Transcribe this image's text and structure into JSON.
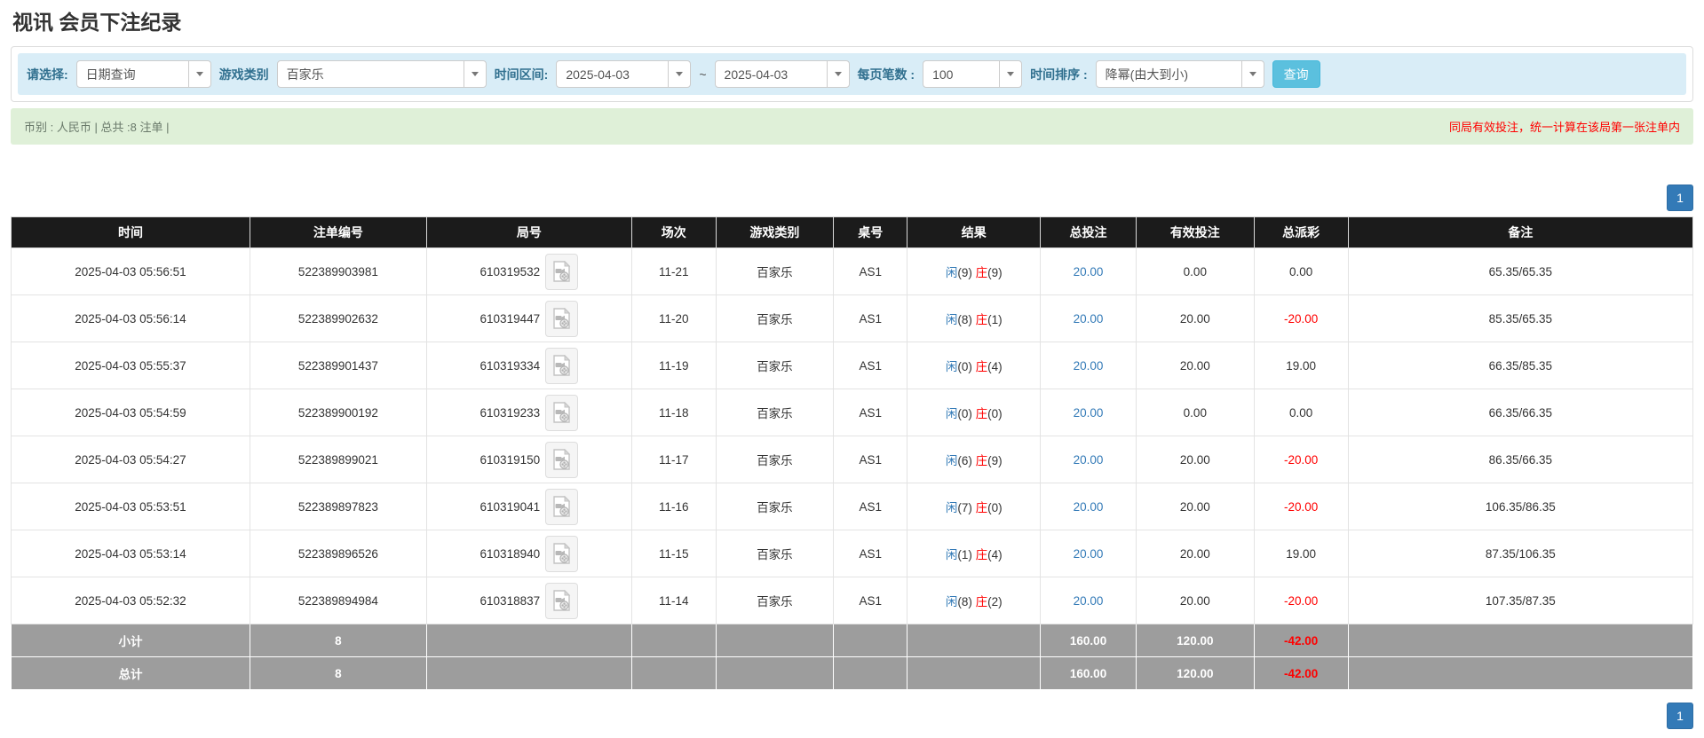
{
  "page": {
    "title": "视讯 会员下注纪录"
  },
  "filters": {
    "select_label": "请选择:",
    "query_type": "日期查询",
    "game_category_label": "游戏类别",
    "game_category": "百家乐",
    "time_range_label": "时间区间:",
    "date_from": "2025-04-03",
    "range_separator": "~",
    "date_to": "2025-04-03",
    "page_size_label": "每页笔数 :",
    "page_size": "100",
    "sort_label": "时间排序 :",
    "sort_order": "降幂(由大到小)",
    "search_button": "查询"
  },
  "summary": {
    "left_text": "币别 : 人民币 | 总共 :8 注单 |",
    "notice": "同局有效投注，统一计算在该局第一张注单内"
  },
  "pagination": {
    "page": "1"
  },
  "colors": {
    "accent_blue": "#337ab7",
    "banker_red": "#ff0000",
    "header_bg": "#1b1b1b",
    "footer_bg": "#9d9d9d",
    "filter_bg": "#d9edf7",
    "summary_bg": "#dff0d8",
    "search_button_bg": "#5bc0de"
  },
  "icons": {
    "video_icon": "video-replay-icon",
    "caret_icon": "chevron-down-icon"
  },
  "table": {
    "headers": [
      "时间",
      "注单编号",
      "局号",
      "场次",
      "游戏类别",
      "桌号",
      "结果",
      "总投注",
      "有效投注",
      "总派彩",
      "备注"
    ],
    "rows": [
      {
        "time": "2025-04-03 05:56:51",
        "bet_id": "522389903981",
        "round_id": "610319532",
        "session": "11-21",
        "game": "百家乐",
        "table_no": "AS1",
        "result": {
          "p_label": "闲",
          "p_val": "(9) ",
          "b_label": "庄",
          "b_val": "(9)"
        },
        "total_bet": "20.00",
        "valid_bet": "0.00",
        "payout": "0.00",
        "remark": "65.35/65.35"
      },
      {
        "time": "2025-04-03 05:56:14",
        "bet_id": "522389902632",
        "round_id": "610319447",
        "session": "11-20",
        "game": "百家乐",
        "table_no": "AS1",
        "result": {
          "p_label": "闲",
          "p_val": "(8) ",
          "b_label": "庄",
          "b_val": "(1)"
        },
        "total_bet": "20.00",
        "valid_bet": "20.00",
        "payout": "-20.00",
        "remark": "85.35/65.35"
      },
      {
        "time": "2025-04-03 05:55:37",
        "bet_id": "522389901437",
        "round_id": "610319334",
        "session": "11-19",
        "game": "百家乐",
        "table_no": "AS1",
        "result": {
          "p_label": "闲",
          "p_val": "(0) ",
          "b_label": "庄",
          "b_val": "(4)"
        },
        "total_bet": "20.00",
        "valid_bet": "20.00",
        "payout": "19.00",
        "remark": "66.35/85.35"
      },
      {
        "time": "2025-04-03 05:54:59",
        "bet_id": "522389900192",
        "round_id": "610319233",
        "session": "11-18",
        "game": "百家乐",
        "table_no": "AS1",
        "result": {
          "p_label": "闲",
          "p_val": "(0) ",
          "b_label": "庄",
          "b_val": "(0)"
        },
        "total_bet": "20.00",
        "valid_bet": "0.00",
        "payout": "0.00",
        "remark": "66.35/66.35"
      },
      {
        "time": "2025-04-03 05:54:27",
        "bet_id": "522389899021",
        "round_id": "610319150",
        "session": "11-17",
        "game": "百家乐",
        "table_no": "AS1",
        "result": {
          "p_label": "闲",
          "p_val": "(6) ",
          "b_label": "庄",
          "b_val": "(9)"
        },
        "total_bet": "20.00",
        "valid_bet": "20.00",
        "payout": "-20.00",
        "remark": "86.35/66.35"
      },
      {
        "time": "2025-04-03 05:53:51",
        "bet_id": "522389897823",
        "round_id": "610319041",
        "session": "11-16",
        "game": "百家乐",
        "table_no": "AS1",
        "result": {
          "p_label": "闲",
          "p_val": "(7) ",
          "b_label": "庄",
          "b_val": "(0)"
        },
        "total_bet": "20.00",
        "valid_bet": "20.00",
        "payout": "-20.00",
        "remark": "106.35/86.35"
      },
      {
        "time": "2025-04-03 05:53:14",
        "bet_id": "522389896526",
        "round_id": "610318940",
        "session": "11-15",
        "game": "百家乐",
        "table_no": "AS1",
        "result": {
          "p_label": "闲",
          "p_val": "(1) ",
          "b_label": "庄",
          "b_val": "(4)"
        },
        "total_bet": "20.00",
        "valid_bet": "20.00",
        "payout": "19.00",
        "remark": "87.35/106.35"
      },
      {
        "time": "2025-04-03 05:52:32",
        "bet_id": "522389894984",
        "round_id": "610318837",
        "session": "11-14",
        "game": "百家乐",
        "table_no": "AS1",
        "result": {
          "p_label": "闲",
          "p_val": "(8) ",
          "b_label": "庄",
          "b_val": "(2)"
        },
        "total_bet": "20.00",
        "valid_bet": "20.00",
        "payout": "-20.00",
        "remark": "107.35/87.35"
      }
    ],
    "footer": [
      {
        "label": "小计",
        "count": "8",
        "total_bet": "160.00",
        "valid_bet": "120.00",
        "payout": "-42.00"
      },
      {
        "label": "总计",
        "count": "8",
        "total_bet": "160.00",
        "valid_bet": "120.00",
        "payout": "-42.00"
      }
    ]
  }
}
